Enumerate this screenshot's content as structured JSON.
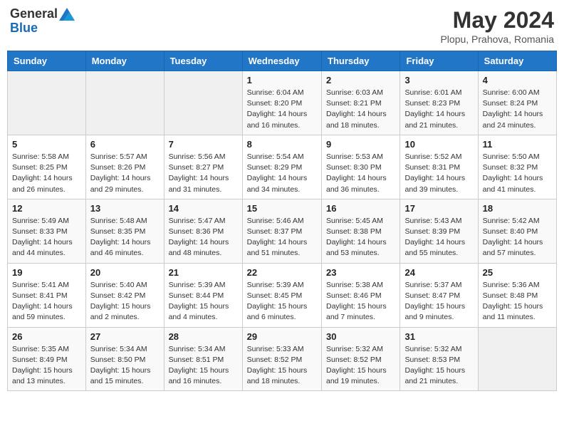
{
  "header": {
    "logo_general": "General",
    "logo_blue": "Blue",
    "month_year": "May 2024",
    "location": "Plopu, Prahova, Romania"
  },
  "weekdays": [
    "Sunday",
    "Monday",
    "Tuesday",
    "Wednesday",
    "Thursday",
    "Friday",
    "Saturday"
  ],
  "weeks": [
    [
      {
        "day": "",
        "sunrise": "",
        "sunset": "",
        "daylight": ""
      },
      {
        "day": "",
        "sunrise": "",
        "sunset": "",
        "daylight": ""
      },
      {
        "day": "",
        "sunrise": "",
        "sunset": "",
        "daylight": ""
      },
      {
        "day": "1",
        "sunrise": "Sunrise: 6:04 AM",
        "sunset": "Sunset: 8:20 PM",
        "daylight": "Daylight: 14 hours and 16 minutes."
      },
      {
        "day": "2",
        "sunrise": "Sunrise: 6:03 AM",
        "sunset": "Sunset: 8:21 PM",
        "daylight": "Daylight: 14 hours and 18 minutes."
      },
      {
        "day": "3",
        "sunrise": "Sunrise: 6:01 AM",
        "sunset": "Sunset: 8:23 PM",
        "daylight": "Daylight: 14 hours and 21 minutes."
      },
      {
        "day": "4",
        "sunrise": "Sunrise: 6:00 AM",
        "sunset": "Sunset: 8:24 PM",
        "daylight": "Daylight: 14 hours and 24 minutes."
      }
    ],
    [
      {
        "day": "5",
        "sunrise": "Sunrise: 5:58 AM",
        "sunset": "Sunset: 8:25 PM",
        "daylight": "Daylight: 14 hours and 26 minutes."
      },
      {
        "day": "6",
        "sunrise": "Sunrise: 5:57 AM",
        "sunset": "Sunset: 8:26 PM",
        "daylight": "Daylight: 14 hours and 29 minutes."
      },
      {
        "day": "7",
        "sunrise": "Sunrise: 5:56 AM",
        "sunset": "Sunset: 8:27 PM",
        "daylight": "Daylight: 14 hours and 31 minutes."
      },
      {
        "day": "8",
        "sunrise": "Sunrise: 5:54 AM",
        "sunset": "Sunset: 8:29 PM",
        "daylight": "Daylight: 14 hours and 34 minutes."
      },
      {
        "day": "9",
        "sunrise": "Sunrise: 5:53 AM",
        "sunset": "Sunset: 8:30 PM",
        "daylight": "Daylight: 14 hours and 36 minutes."
      },
      {
        "day": "10",
        "sunrise": "Sunrise: 5:52 AM",
        "sunset": "Sunset: 8:31 PM",
        "daylight": "Daylight: 14 hours and 39 minutes."
      },
      {
        "day": "11",
        "sunrise": "Sunrise: 5:50 AM",
        "sunset": "Sunset: 8:32 PM",
        "daylight": "Daylight: 14 hours and 41 minutes."
      }
    ],
    [
      {
        "day": "12",
        "sunrise": "Sunrise: 5:49 AM",
        "sunset": "Sunset: 8:33 PM",
        "daylight": "Daylight: 14 hours and 44 minutes."
      },
      {
        "day": "13",
        "sunrise": "Sunrise: 5:48 AM",
        "sunset": "Sunset: 8:35 PM",
        "daylight": "Daylight: 14 hours and 46 minutes."
      },
      {
        "day": "14",
        "sunrise": "Sunrise: 5:47 AM",
        "sunset": "Sunset: 8:36 PM",
        "daylight": "Daylight: 14 hours and 48 minutes."
      },
      {
        "day": "15",
        "sunrise": "Sunrise: 5:46 AM",
        "sunset": "Sunset: 8:37 PM",
        "daylight": "Daylight: 14 hours and 51 minutes."
      },
      {
        "day": "16",
        "sunrise": "Sunrise: 5:45 AM",
        "sunset": "Sunset: 8:38 PM",
        "daylight": "Daylight: 14 hours and 53 minutes."
      },
      {
        "day": "17",
        "sunrise": "Sunrise: 5:43 AM",
        "sunset": "Sunset: 8:39 PM",
        "daylight": "Daylight: 14 hours and 55 minutes."
      },
      {
        "day": "18",
        "sunrise": "Sunrise: 5:42 AM",
        "sunset": "Sunset: 8:40 PM",
        "daylight": "Daylight: 14 hours and 57 minutes."
      }
    ],
    [
      {
        "day": "19",
        "sunrise": "Sunrise: 5:41 AM",
        "sunset": "Sunset: 8:41 PM",
        "daylight": "Daylight: 14 hours and 59 minutes."
      },
      {
        "day": "20",
        "sunrise": "Sunrise: 5:40 AM",
        "sunset": "Sunset: 8:42 PM",
        "daylight": "Daylight: 15 hours and 2 minutes."
      },
      {
        "day": "21",
        "sunrise": "Sunrise: 5:39 AM",
        "sunset": "Sunset: 8:44 PM",
        "daylight": "Daylight: 15 hours and 4 minutes."
      },
      {
        "day": "22",
        "sunrise": "Sunrise: 5:39 AM",
        "sunset": "Sunset: 8:45 PM",
        "daylight": "Daylight: 15 hours and 6 minutes."
      },
      {
        "day": "23",
        "sunrise": "Sunrise: 5:38 AM",
        "sunset": "Sunset: 8:46 PM",
        "daylight": "Daylight: 15 hours and 7 minutes."
      },
      {
        "day": "24",
        "sunrise": "Sunrise: 5:37 AM",
        "sunset": "Sunset: 8:47 PM",
        "daylight": "Daylight: 15 hours and 9 minutes."
      },
      {
        "day": "25",
        "sunrise": "Sunrise: 5:36 AM",
        "sunset": "Sunset: 8:48 PM",
        "daylight": "Daylight: 15 hours and 11 minutes."
      }
    ],
    [
      {
        "day": "26",
        "sunrise": "Sunrise: 5:35 AM",
        "sunset": "Sunset: 8:49 PM",
        "daylight": "Daylight: 15 hours and 13 minutes."
      },
      {
        "day": "27",
        "sunrise": "Sunrise: 5:34 AM",
        "sunset": "Sunset: 8:50 PM",
        "daylight": "Daylight: 15 hours and 15 minutes."
      },
      {
        "day": "28",
        "sunrise": "Sunrise: 5:34 AM",
        "sunset": "Sunset: 8:51 PM",
        "daylight": "Daylight: 15 hours and 16 minutes."
      },
      {
        "day": "29",
        "sunrise": "Sunrise: 5:33 AM",
        "sunset": "Sunset: 8:52 PM",
        "daylight": "Daylight: 15 hours and 18 minutes."
      },
      {
        "day": "30",
        "sunrise": "Sunrise: 5:32 AM",
        "sunset": "Sunset: 8:52 PM",
        "daylight": "Daylight: 15 hours and 19 minutes."
      },
      {
        "day": "31",
        "sunrise": "Sunrise: 5:32 AM",
        "sunset": "Sunset: 8:53 PM",
        "daylight": "Daylight: 15 hours and 21 minutes."
      },
      {
        "day": "",
        "sunrise": "",
        "sunset": "",
        "daylight": ""
      }
    ]
  ]
}
